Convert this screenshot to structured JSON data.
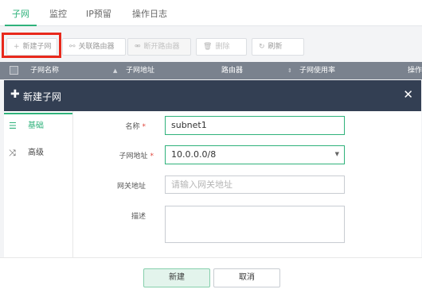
{
  "tabs": [
    {
      "label": "子网",
      "active": true
    },
    {
      "label": "监控"
    },
    {
      "label": "IP预留"
    },
    {
      "label": "操作日志"
    }
  ],
  "toolbar": {
    "new_label": "新建子网",
    "assoc_label": "关联路由器",
    "disassoc_label": "断开路由器",
    "delete_label": "删除",
    "refresh_label": "刷新"
  },
  "table": {
    "headers": [
      "子网名称",
      "子网地址",
      "路由器",
      "子网使用率",
      "操作"
    ]
  },
  "modal": {
    "title": "新建子网",
    "side_items": [
      "基础",
      "高级"
    ],
    "form": {
      "name_label": "名称",
      "name_value": "subnet1",
      "cidr_label": "子网地址",
      "cidr_value": "10.0.0.0/8",
      "gateway_label": "网关地址",
      "gateway_placeholder": "请输入网关地址",
      "desc_label": "描述",
      "required_mark": "*"
    },
    "create_label": "新建",
    "cancel_label": "取消"
  },
  "colors": {
    "accent": "#2fb27b",
    "modal_header": "#333f53",
    "table_header": "#7a828e",
    "highlight": "#e8291c"
  }
}
